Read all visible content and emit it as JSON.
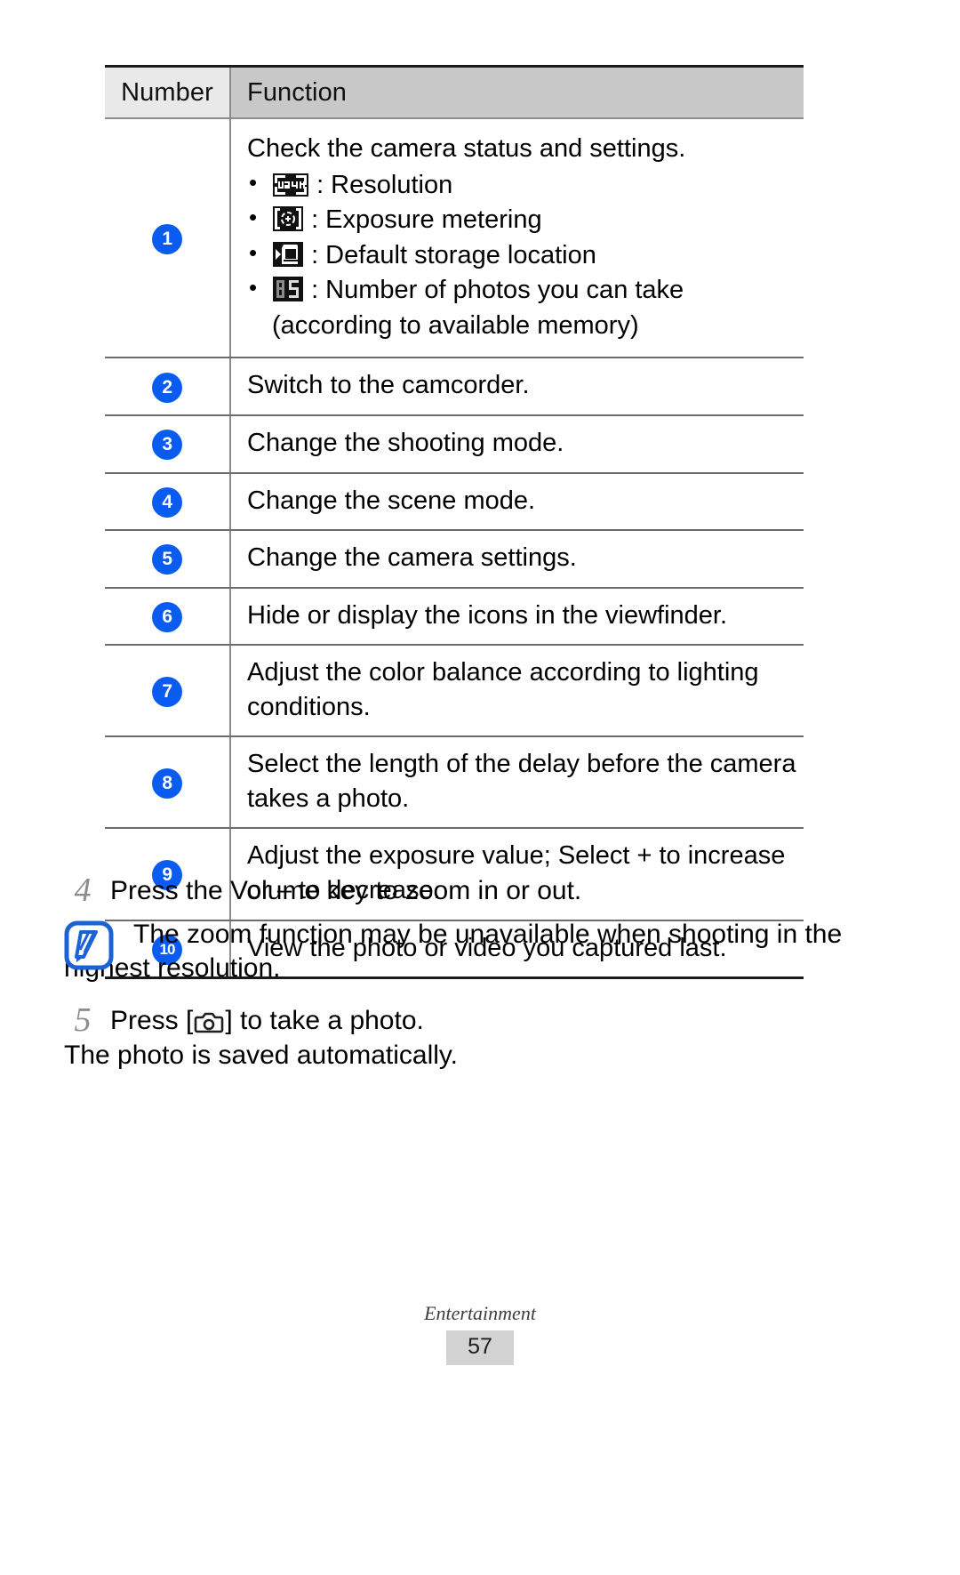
{
  "table": {
    "headers": [
      "Number",
      "Function"
    ],
    "rows": [
      {
        "number": "1",
        "lead": "Check the camera status and settings.",
        "bullets": [
          {
            "icon": "resolution-lcd-icon",
            "icon_text": "W24M",
            "label": ": Resolution"
          },
          {
            "icon": "exposure-metering-lcd-icon",
            "icon_text": "",
            "label": ": Exposure metering"
          },
          {
            "icon": "default-storage-location-lcd-icon",
            "icon_text": "",
            "label": ": Default storage location"
          },
          {
            "icon": "photo-counter-lcd-icon",
            "icon_text": "85",
            "label": ": Number of photos you can take"
          }
        ],
        "continuation": "(according to available memory)"
      },
      {
        "number": "2",
        "text": "Switch to the camcorder."
      },
      {
        "number": "3",
        "text": "Change the shooting mode."
      },
      {
        "number": "4",
        "text": "Change the scene mode."
      },
      {
        "number": "5",
        "text": "Change the camera settings."
      },
      {
        "number": "6",
        "text": "Hide or display the icons in the viewfinder."
      },
      {
        "number": "7",
        "text": "Adjust the color balance according to lighting conditions."
      },
      {
        "number": "8",
        "text": "Select the length of the delay before the camera takes a photo."
      },
      {
        "number": "9",
        "text": "Adjust the exposure value; Select + to increase or – to decrease."
      },
      {
        "number": "10",
        "text": "View the photo or video you captured last."
      }
    ]
  },
  "steps": [
    {
      "num": "4",
      "text": "Press the Volume key to zoom in or out."
    }
  ],
  "note": {
    "icon": "note-pencil-icon",
    "text": "The zoom function may be unavailable when shooting in the highest resolution."
  },
  "step5": {
    "num": "5",
    "before": "Press [",
    "icon": "camera-shutter-icon",
    "after": "] to take a photo.",
    "line2": "The photo is saved automatically."
  },
  "footer": {
    "chapter": "Entertainment",
    "page": "57"
  },
  "colors": {
    "badge_blue": "#0a5bf0",
    "note_blue": "#1a62d6",
    "header_fn_bg": "#c8c8c8",
    "header_num_bg": "#e9e9e9",
    "page_box_bg": "#d2d2d2",
    "step_num_gray": "#8d8d8d"
  }
}
